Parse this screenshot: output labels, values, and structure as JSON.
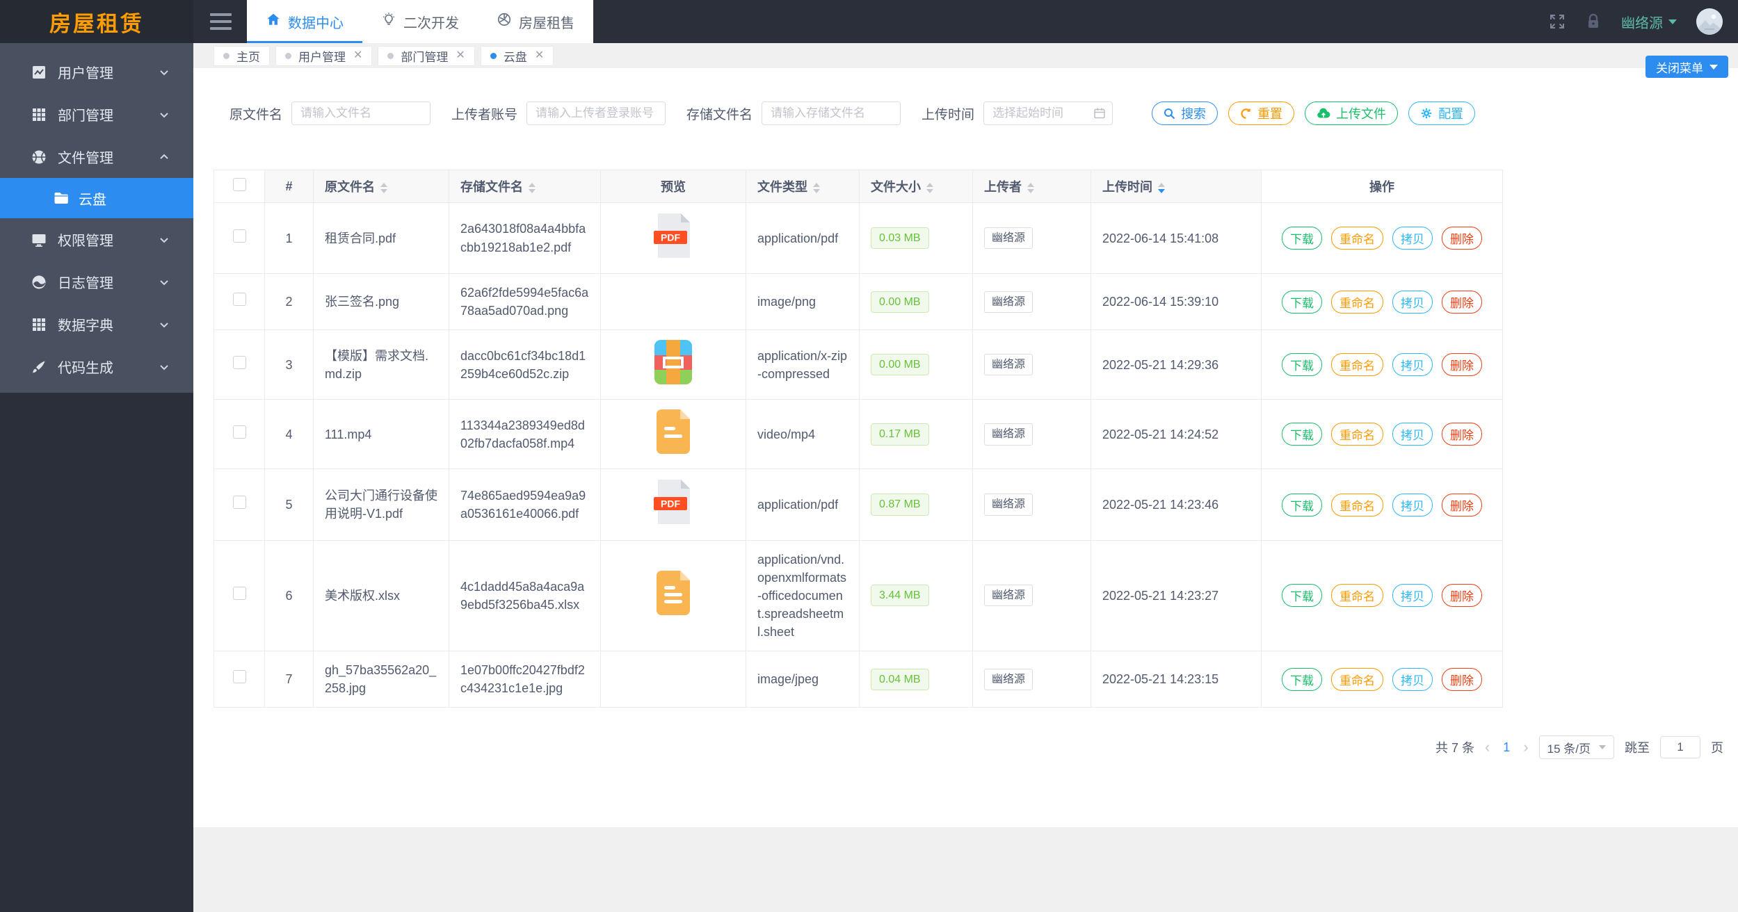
{
  "app": {
    "logo": "房屋租赁",
    "colors": {
      "primary": "#2d8cf0",
      "success": "#19be6b",
      "warning": "#ff9900",
      "error": "#ed4014",
      "info": "#2db7f5",
      "sidebar": "#495060",
      "header_dark": "#2b2f3a",
      "logo_text": "#ff9c00",
      "user_name": "#5cbaa2"
    }
  },
  "header": {
    "nav": [
      {
        "label": "数据中心",
        "icon": "home-icon",
        "active": true
      },
      {
        "label": "二次开发",
        "icon": "bulb-icon",
        "active": false
      },
      {
        "label": "房屋租售",
        "icon": "aperture-icon",
        "active": false
      }
    ],
    "icons": [
      "fullscreen-icon",
      "lock-icon"
    ],
    "user": {
      "name": "幽络源"
    }
  },
  "sidebar": {
    "items": [
      {
        "label": "用户管理",
        "icon": "chart-icon"
      },
      {
        "label": "部门管理",
        "icon": "grid-icon"
      },
      {
        "label": "文件管理",
        "icon": "sphere-icon",
        "expanded": true,
        "children": [
          {
            "label": "云盘",
            "icon": "folder-icon",
            "active": true
          }
        ]
      },
      {
        "label": "权限管理",
        "icon": "monitor-icon"
      },
      {
        "label": "日志管理",
        "icon": "pie-icon"
      },
      {
        "label": "数据字典",
        "icon": "grid-icon"
      },
      {
        "label": "代码生成",
        "icon": "brush-icon"
      }
    ]
  },
  "tabstrip": {
    "tabs": [
      {
        "label": "主页",
        "closable": false,
        "active": false
      },
      {
        "label": "用户管理",
        "closable": true,
        "active": false
      },
      {
        "label": "部门管理",
        "closable": true,
        "active": false
      },
      {
        "label": "云盘",
        "closable": true,
        "active": true
      }
    ],
    "close_menu_label": "关闭菜单"
  },
  "search": {
    "fields": [
      {
        "label": "原文件名",
        "placeholder": "请输入文件名"
      },
      {
        "label": "上传者账号",
        "placeholder": "请输入上传者登录账号"
      },
      {
        "label": "存储文件名",
        "placeholder": "请输入存储文件名"
      },
      {
        "label": "上传时间",
        "placeholder": "选择起始时间",
        "icon": "calendar-icon"
      }
    ],
    "buttons": [
      {
        "label": "搜索",
        "icon": "search-icon",
        "color": "#2d8cf0"
      },
      {
        "label": "重置",
        "icon": "refresh-icon",
        "color": "#ff9900"
      },
      {
        "label": "上传文件",
        "icon": "cloud-upload-icon",
        "color": "#19be6b"
      },
      {
        "label": "配置",
        "icon": "gear-icon",
        "color": "#2db7f5"
      }
    ]
  },
  "table": {
    "headers": [
      "#",
      "原文件名",
      "存储文件名",
      "预览",
      "文件类型",
      "文件大小",
      "上传者",
      "上传时间",
      "操作"
    ],
    "sorted_by": "上传时间",
    "sort_direction": "desc",
    "action_labels": [
      "下载",
      "重命名",
      "拷贝",
      "删除"
    ],
    "rows": [
      {
        "index": "1",
        "name": "租赁合同.pdf",
        "stored": "2a643018f08a4a4bbfacbb19218ab1e2.pdf",
        "preview": "pdf-icon",
        "mime": "application/pdf",
        "size": "0.03 MB",
        "uploader": "幽络源",
        "time": "2022-06-14 15:41:08"
      },
      {
        "index": "2",
        "name": "张三签名.png",
        "stored": "62a6f2fde5994e5fac6a78aa5ad070ad.png",
        "preview": "none",
        "mime": "image/png",
        "size": "0.00 MB",
        "uploader": "幽络源",
        "time": "2022-06-14 15:39:10"
      },
      {
        "index": "3",
        "name": "【模版】需求文档.md.zip",
        "stored": "dacc0bc61cf34bc18d1259b4ce60d52c.zip",
        "preview": "zip-icon",
        "mime": "application/x-zip-compressed",
        "size": "0.00 MB",
        "uploader": "幽络源",
        "time": "2022-05-21 14:29:36"
      },
      {
        "index": "4",
        "name": "111.mp4",
        "stored": "113344a2389349ed8d02fb7dacfa058f.mp4",
        "preview": "doc-icon",
        "mime": "video/mp4",
        "size": "0.17 MB",
        "uploader": "幽络源",
        "time": "2022-05-21 14:24:52"
      },
      {
        "index": "5",
        "name": "公司大门通行设备使用说明-V1.pdf",
        "stored": "74e865aed9594ea9a9a0536161e40066.pdf",
        "preview": "pdf-icon",
        "mime": "application/pdf",
        "size": "0.87 MB",
        "uploader": "幽络源",
        "time": "2022-05-21 14:23:46"
      },
      {
        "index": "6",
        "name": "美术版权.xlsx",
        "stored": "4c1dadd45a8a4aca9a9ebd5f3256ba45.xlsx",
        "preview": "doc-icon",
        "mime": "application/vnd.openxmlformats-officedocument.spreadsheetml.sheet",
        "size": "3.44 MB",
        "uploader": "幽络源",
        "time": "2022-05-21 14:23:27"
      },
      {
        "index": "7",
        "name": "gh_57ba35562a20_258.jpg",
        "stored": "1e07b00ffc20427fbdf2c434231c1e1e.jpg",
        "preview": "none",
        "mime": "image/jpeg",
        "size": "0.04 MB",
        "uploader": "幽络源",
        "time": "2022-05-21 14:23:15"
      }
    ]
  },
  "pagination": {
    "total": "共 7 条",
    "page": "1",
    "page_size": "15 条/页",
    "jump_label": "跳至",
    "jump_value": "1",
    "page_suffix": "页"
  }
}
